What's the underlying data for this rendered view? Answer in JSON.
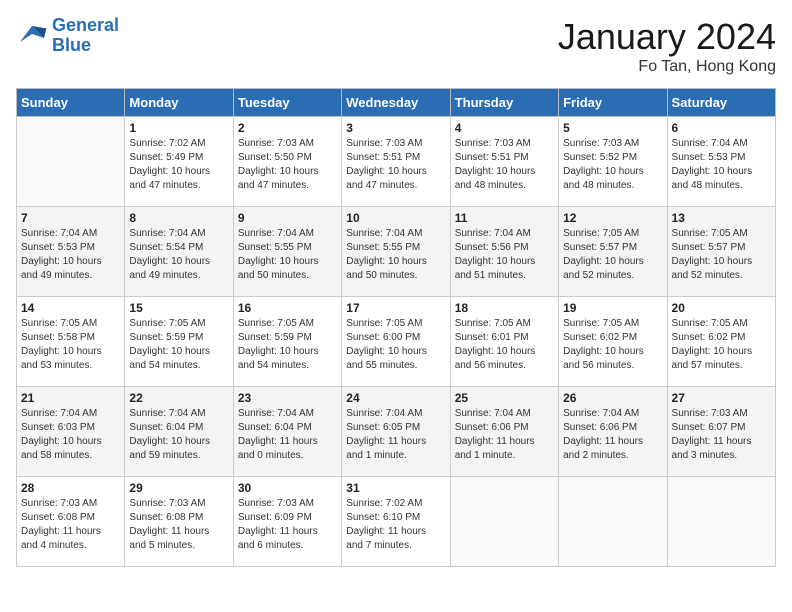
{
  "header": {
    "logo_line1": "General",
    "logo_line2": "Blue",
    "month": "January 2024",
    "location": "Fo Tan, Hong Kong"
  },
  "weekdays": [
    "Sunday",
    "Monday",
    "Tuesday",
    "Wednesday",
    "Thursday",
    "Friday",
    "Saturday"
  ],
  "weeks": [
    [
      {
        "day": "",
        "info": ""
      },
      {
        "day": "1",
        "info": "Sunrise: 7:02 AM\nSunset: 5:49 PM\nDaylight: 10 hours\nand 47 minutes."
      },
      {
        "day": "2",
        "info": "Sunrise: 7:03 AM\nSunset: 5:50 PM\nDaylight: 10 hours\nand 47 minutes."
      },
      {
        "day": "3",
        "info": "Sunrise: 7:03 AM\nSunset: 5:51 PM\nDaylight: 10 hours\nand 47 minutes."
      },
      {
        "day": "4",
        "info": "Sunrise: 7:03 AM\nSunset: 5:51 PM\nDaylight: 10 hours\nand 48 minutes."
      },
      {
        "day": "5",
        "info": "Sunrise: 7:03 AM\nSunset: 5:52 PM\nDaylight: 10 hours\nand 48 minutes."
      },
      {
        "day": "6",
        "info": "Sunrise: 7:04 AM\nSunset: 5:53 PM\nDaylight: 10 hours\nand 48 minutes."
      }
    ],
    [
      {
        "day": "7",
        "info": "Sunrise: 7:04 AM\nSunset: 5:53 PM\nDaylight: 10 hours\nand 49 minutes."
      },
      {
        "day": "8",
        "info": "Sunrise: 7:04 AM\nSunset: 5:54 PM\nDaylight: 10 hours\nand 49 minutes."
      },
      {
        "day": "9",
        "info": "Sunrise: 7:04 AM\nSunset: 5:55 PM\nDaylight: 10 hours\nand 50 minutes."
      },
      {
        "day": "10",
        "info": "Sunrise: 7:04 AM\nSunset: 5:55 PM\nDaylight: 10 hours\nand 50 minutes."
      },
      {
        "day": "11",
        "info": "Sunrise: 7:04 AM\nSunset: 5:56 PM\nDaylight: 10 hours\nand 51 minutes."
      },
      {
        "day": "12",
        "info": "Sunrise: 7:05 AM\nSunset: 5:57 PM\nDaylight: 10 hours\nand 52 minutes."
      },
      {
        "day": "13",
        "info": "Sunrise: 7:05 AM\nSunset: 5:57 PM\nDaylight: 10 hours\nand 52 minutes."
      }
    ],
    [
      {
        "day": "14",
        "info": "Sunrise: 7:05 AM\nSunset: 5:58 PM\nDaylight: 10 hours\nand 53 minutes."
      },
      {
        "day": "15",
        "info": "Sunrise: 7:05 AM\nSunset: 5:59 PM\nDaylight: 10 hours\nand 54 minutes."
      },
      {
        "day": "16",
        "info": "Sunrise: 7:05 AM\nSunset: 5:59 PM\nDaylight: 10 hours\nand 54 minutes."
      },
      {
        "day": "17",
        "info": "Sunrise: 7:05 AM\nSunset: 6:00 PM\nDaylight: 10 hours\nand 55 minutes."
      },
      {
        "day": "18",
        "info": "Sunrise: 7:05 AM\nSunset: 6:01 PM\nDaylight: 10 hours\nand 56 minutes."
      },
      {
        "day": "19",
        "info": "Sunrise: 7:05 AM\nSunset: 6:02 PM\nDaylight: 10 hours\nand 56 minutes."
      },
      {
        "day": "20",
        "info": "Sunrise: 7:05 AM\nSunset: 6:02 PM\nDaylight: 10 hours\nand 57 minutes."
      }
    ],
    [
      {
        "day": "21",
        "info": "Sunrise: 7:04 AM\nSunset: 6:03 PM\nDaylight: 10 hours\nand 58 minutes."
      },
      {
        "day": "22",
        "info": "Sunrise: 7:04 AM\nSunset: 6:04 PM\nDaylight: 10 hours\nand 59 minutes."
      },
      {
        "day": "23",
        "info": "Sunrise: 7:04 AM\nSunset: 6:04 PM\nDaylight: 11 hours\nand 0 minutes."
      },
      {
        "day": "24",
        "info": "Sunrise: 7:04 AM\nSunset: 6:05 PM\nDaylight: 11 hours\nand 1 minute."
      },
      {
        "day": "25",
        "info": "Sunrise: 7:04 AM\nSunset: 6:06 PM\nDaylight: 11 hours\nand 1 minute."
      },
      {
        "day": "26",
        "info": "Sunrise: 7:04 AM\nSunset: 6:06 PM\nDaylight: 11 hours\nand 2 minutes."
      },
      {
        "day": "27",
        "info": "Sunrise: 7:03 AM\nSunset: 6:07 PM\nDaylight: 11 hours\nand 3 minutes."
      }
    ],
    [
      {
        "day": "28",
        "info": "Sunrise: 7:03 AM\nSunset: 6:08 PM\nDaylight: 11 hours\nand 4 minutes."
      },
      {
        "day": "29",
        "info": "Sunrise: 7:03 AM\nSunset: 6:08 PM\nDaylight: 11 hours\nand 5 minutes."
      },
      {
        "day": "30",
        "info": "Sunrise: 7:03 AM\nSunset: 6:09 PM\nDaylight: 11 hours\nand 6 minutes."
      },
      {
        "day": "31",
        "info": "Sunrise: 7:02 AM\nSunset: 6:10 PM\nDaylight: 11 hours\nand 7 minutes."
      },
      {
        "day": "",
        "info": ""
      },
      {
        "day": "",
        "info": ""
      },
      {
        "day": "",
        "info": ""
      }
    ]
  ]
}
